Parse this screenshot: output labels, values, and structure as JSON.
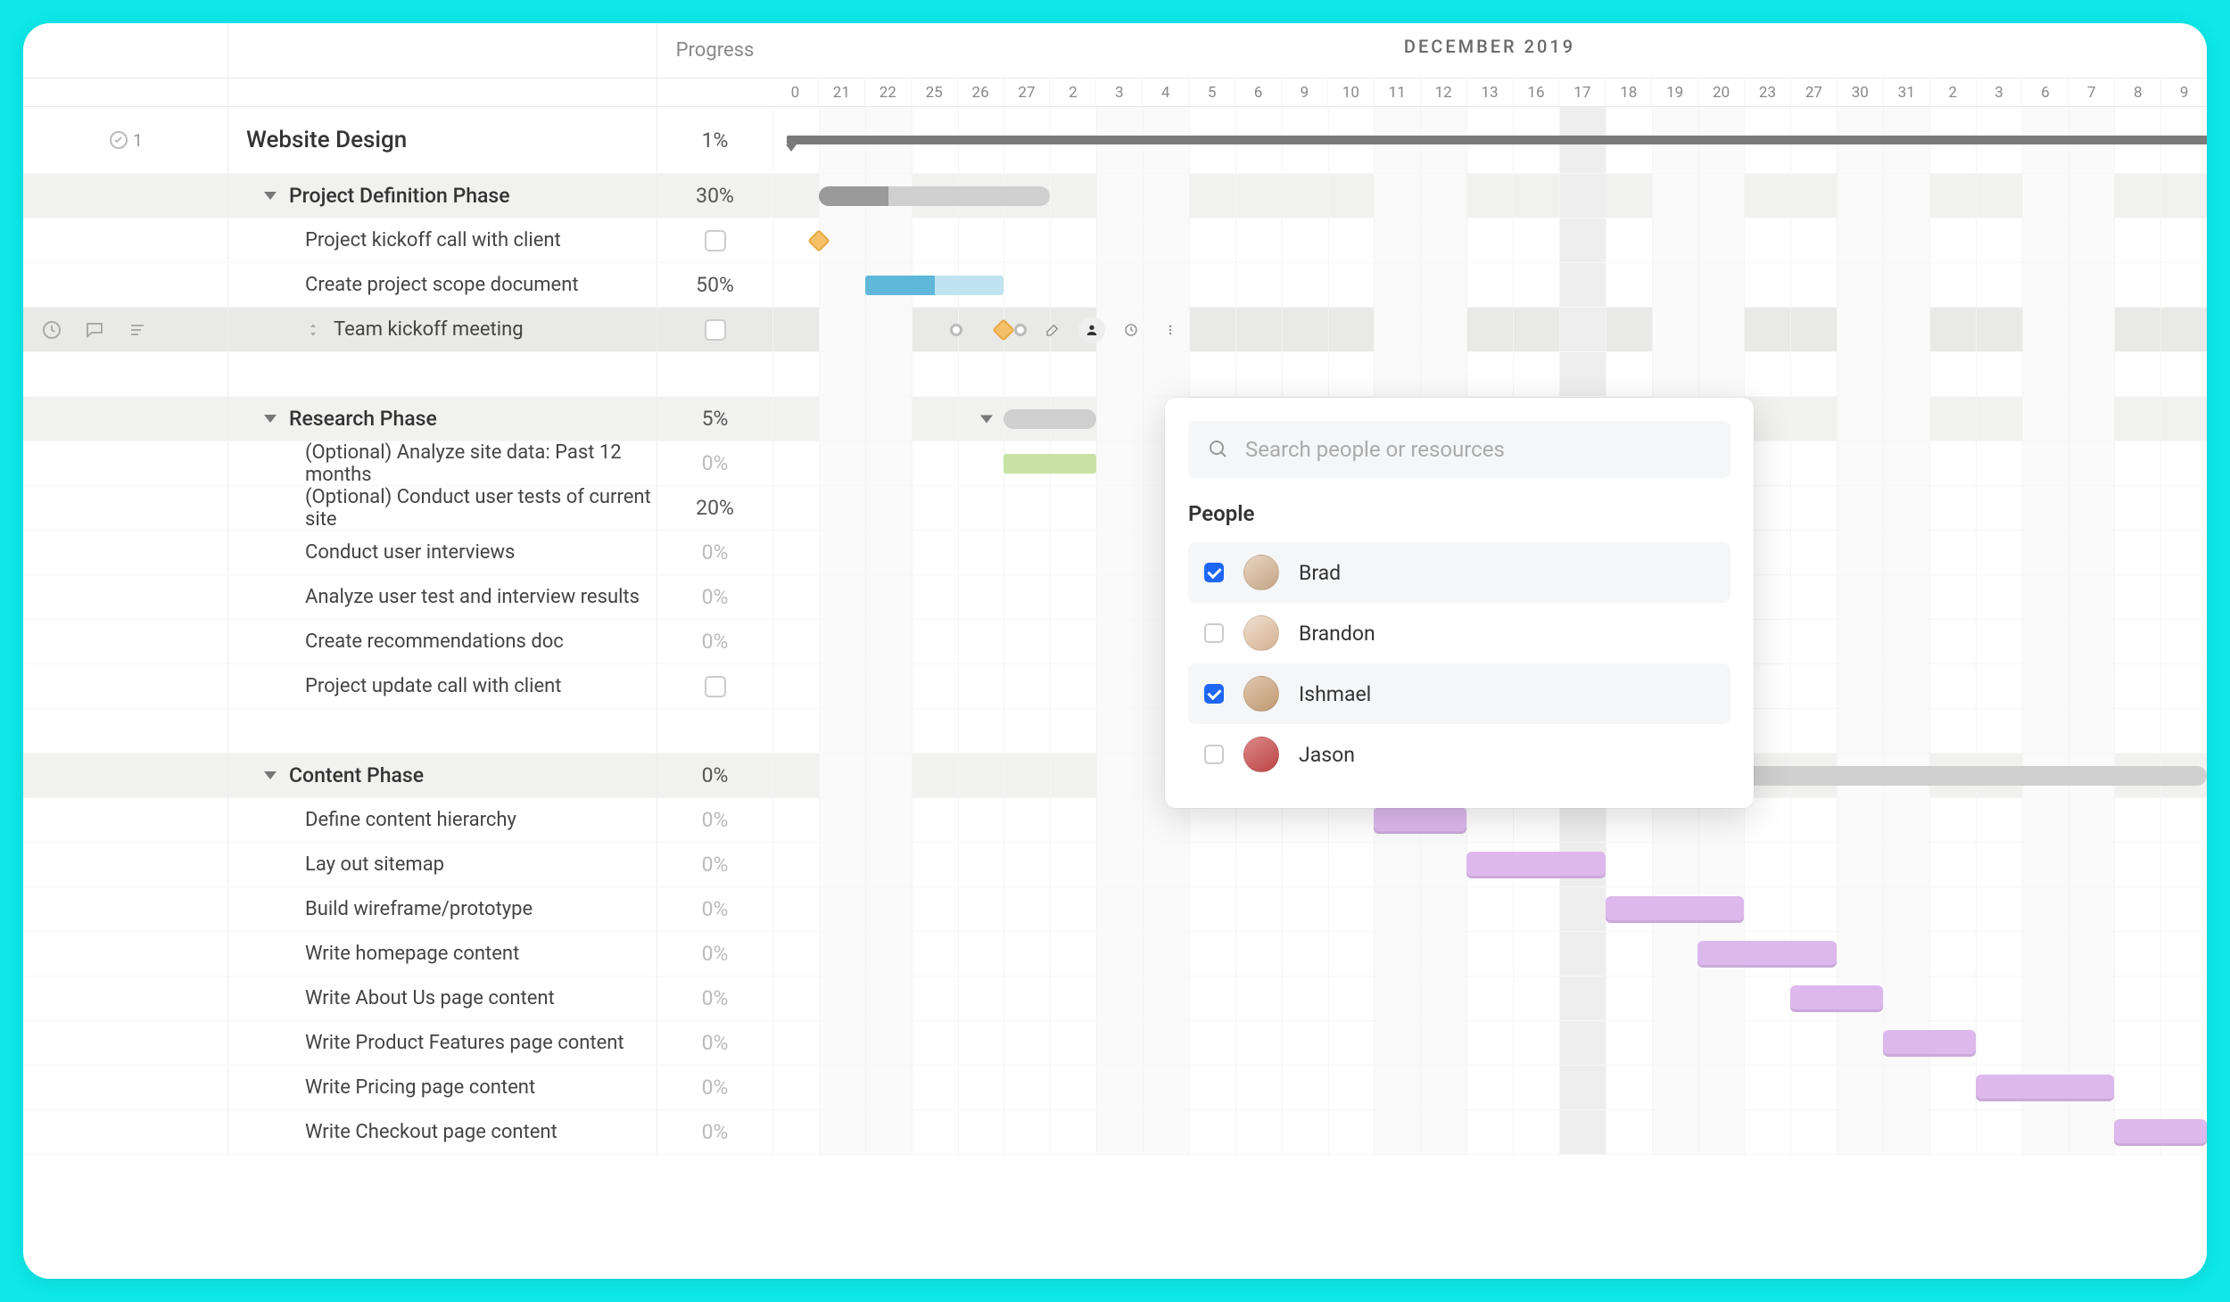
{
  "header": {
    "progress_label": "Progress",
    "month_label": "DECEMBER 2019",
    "dates": [
      "0",
      "21",
      "22",
      "25",
      "26",
      "27",
      "2",
      "3",
      "4",
      "5",
      "6",
      "9",
      "10",
      "11",
      "12",
      "13",
      "16",
      "17",
      "18",
      "19",
      "20",
      "23",
      "27",
      "30",
      "31",
      "2",
      "3",
      "6",
      "7",
      "8",
      "9"
    ]
  },
  "weekend_indices": [
    1,
    2,
    7,
    8,
    13,
    14,
    19,
    20,
    23,
    24,
    27,
    28
  ],
  "today_index": 17,
  "project": {
    "name": "Website Design",
    "progress": "1%",
    "comment_count": "1"
  },
  "rows": [
    {
      "type": "phase",
      "name": "Project Definition Phase",
      "progress": "30%",
      "bar": {
        "kind": "gray",
        "start": 1,
        "span": 5,
        "fill": 30
      }
    },
    {
      "type": "task",
      "name": "Project kickoff call with client",
      "progress": "checkbox",
      "milestone": {
        "pos": 1
      }
    },
    {
      "type": "task",
      "name": "Create project scope document",
      "progress": "50%",
      "bar": {
        "kind": "blue",
        "start": 2,
        "span": 3,
        "fill": 50
      }
    },
    {
      "type": "task",
      "name": "Team kickoff meeting",
      "progress": "checkbox",
      "highlighted": true,
      "milestone": {
        "pos": 5,
        "toolbar": true
      }
    },
    {
      "type": "spacer"
    },
    {
      "type": "phase",
      "name": "Research Phase",
      "progress": "5%",
      "bar": {
        "kind": "gray",
        "start": 5,
        "span": 2
      },
      "collapse_arrow": true
    },
    {
      "type": "task",
      "name": "(Optional) Analyze site data: Past 12 months",
      "progress": "0%",
      "faded": true,
      "bar": {
        "kind": "green",
        "start": 5,
        "span": 2
      }
    },
    {
      "type": "task",
      "name": "(Optional) Conduct user tests of current site",
      "progress": "20%"
    },
    {
      "type": "task",
      "name": "Conduct user interviews",
      "progress": "0%",
      "faded": true
    },
    {
      "type": "task",
      "name": "Analyze user test and interview results",
      "progress": "0%",
      "faded": true
    },
    {
      "type": "task",
      "name": "Create recommendations doc",
      "progress": "0%",
      "faded": true
    },
    {
      "type": "task",
      "name": "Project update call with client",
      "progress": "checkbox"
    },
    {
      "type": "spacer"
    },
    {
      "type": "phase",
      "name": "Content Phase",
      "progress": "0%",
      "bar": {
        "kind": "gray",
        "start": 13,
        "span": 18,
        "wide_summary": true
      }
    },
    {
      "type": "task",
      "name": "Define content hierarchy",
      "progress": "0%",
      "faded": true,
      "bar": {
        "kind": "purple",
        "start": 13,
        "span": 2
      }
    },
    {
      "type": "task",
      "name": "Lay out sitemap",
      "progress": "0%",
      "faded": true,
      "bar": {
        "kind": "purple",
        "start": 15,
        "span": 3
      }
    },
    {
      "type": "task",
      "name": "Build wireframe/prototype",
      "progress": "0%",
      "faded": true,
      "bar": {
        "kind": "purple",
        "start": 18,
        "span": 3
      }
    },
    {
      "type": "task",
      "name": "Write homepage content",
      "progress": "0%",
      "faded": true,
      "bar": {
        "kind": "purple",
        "start": 20,
        "span": 3
      }
    },
    {
      "type": "task",
      "name": "Write About Us page content",
      "progress": "0%",
      "faded": true,
      "bar": {
        "kind": "purple",
        "start": 22,
        "span": 2
      }
    },
    {
      "type": "task",
      "name": "Write Product Features page content",
      "progress": "0%",
      "faded": true,
      "bar": {
        "kind": "purple",
        "start": 24,
        "span": 2
      }
    },
    {
      "type": "task",
      "name": "Write Pricing page content",
      "progress": "0%",
      "faded": true,
      "bar": {
        "kind": "purple",
        "start": 26,
        "span": 3
      }
    },
    {
      "type": "task",
      "name": "Write Checkout page content",
      "progress": "0%",
      "faded": true,
      "bar": {
        "kind": "purple",
        "start": 29,
        "span": 2
      }
    }
  ],
  "popover": {
    "search_placeholder": "Search people or resources",
    "section_title": "People",
    "people": [
      {
        "name": "Brad",
        "checked": true
      },
      {
        "name": "Brandon",
        "checked": false
      },
      {
        "name": "Ishmael",
        "checked": true
      },
      {
        "name": "Jason",
        "checked": false
      }
    ]
  }
}
